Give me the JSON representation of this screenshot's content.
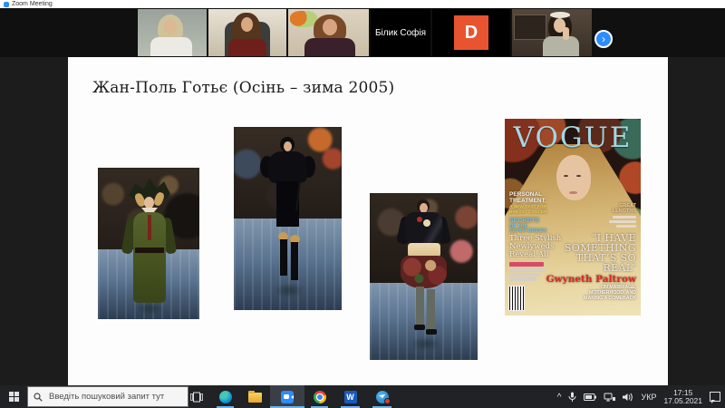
{
  "window": {
    "title": "Zoom Meeting"
  },
  "strip": {
    "participant_name": "Білик Софія",
    "avatar_initial": "D"
  },
  "gallery_next_glyph": "›",
  "slide": {
    "title": "Жан-Поль Готьє (Осінь – зима 2005)"
  },
  "vogue": {
    "masthead": "VOGUE",
    "left_lines": [
      "PERSONAL",
      "TREATMENT:",
      "A NEW TEST FOR",
      "BREAST CANCER",
      "SECRETS",
      "OF THE",
      "SUPER BRIDES",
      "Three Stylish",
      "Newlyweds",
      "Reveal All"
    ],
    "right_lines": [
      "GREAT",
      "LENGTHS"
    ],
    "statement": [
      "“I HAVE",
      "SOMETHING",
      "THAT’S SO",
      "REAL”"
    ],
    "cover_star": "Gwyneth Paltrow",
    "sub_lines": [
      "ON MARRIAGE,",
      "MOTHERHOOD, AND",
      "MAKING A COMEBACK"
    ]
  },
  "taskbar": {
    "search_placeholder": "Введіть пошуковий запит тут",
    "word_label": "W",
    "tray": {
      "expand_glyph": "^",
      "language": "УКР",
      "time": "17:15",
      "date": "17.05.2021"
    }
  },
  "icons": {
    "zoom_app": "blue-rounded-square",
    "gallery_next": "chevron-right-in-blue-circle",
    "start": "windows-grid",
    "search": "magnifier",
    "task_view": "filmstrip",
    "edge": "blue-teal-circle",
    "file_explorer": "yellow-folder",
    "zoom_taskbar": "blue-camera-tile",
    "chrome": "multicolor-circle",
    "word": "blue-w-tile",
    "messenger": "blue-circle-with-red-badge",
    "mic": "microphone",
    "battery": "battery",
    "network": "network",
    "volume": "speaker",
    "action_center": "notification-square"
  },
  "colors": {
    "zoom_accent": "#2D8CFF",
    "avatar_orange": "#E8542F",
    "vogue_masthead_blue": "#A3D6E6",
    "cover_star_red": "#E02820",
    "taskbar_underline": "#6CB2E8",
    "slide_bg": "#FDFDFD",
    "desktop_bg": "#1C1C1C"
  }
}
